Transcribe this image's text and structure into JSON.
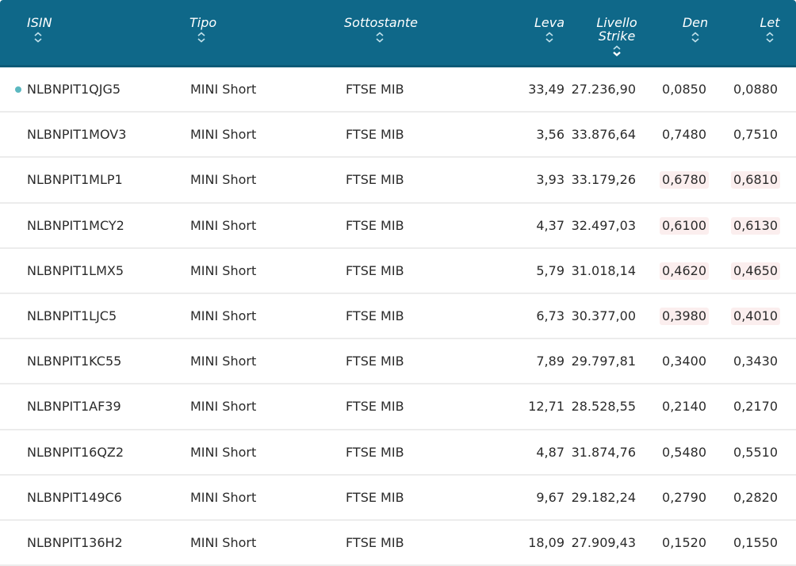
{
  "table": {
    "headers": {
      "isin": "ISIN",
      "tipo": "Tipo",
      "sottostante": "Sottostante",
      "leva": "Leva",
      "strike_line1": "Livello",
      "strike_line2": "Strike",
      "den": "Den",
      "let": "Let"
    },
    "sort_active_column": "strike",
    "colors": {
      "header_bg": "#0f6889",
      "dot": "#5bb8c0",
      "neg_highlight": "#fbeeee"
    },
    "rows": [
      {
        "isin": "NLBNPIT1QJG5",
        "tipo": "MINI Short",
        "sottostante": "FTSE MIB",
        "leva": "33,49",
        "strike": "27.236,90",
        "den": "0,0850",
        "let": "0,0880",
        "dot": true,
        "highlight": false
      },
      {
        "isin": "NLBNPIT1MOV3",
        "tipo": "MINI Short",
        "sottostante": "FTSE MIB",
        "leva": "3,56",
        "strike": "33.876,64",
        "den": "0,7480",
        "let": "0,7510",
        "dot": false,
        "highlight": false
      },
      {
        "isin": "NLBNPIT1MLP1",
        "tipo": "MINI Short",
        "sottostante": "FTSE MIB",
        "leva": "3,93",
        "strike": "33.179,26",
        "den": "0,6780",
        "let": "0,6810",
        "dot": false,
        "highlight": true
      },
      {
        "isin": "NLBNPIT1MCY2",
        "tipo": "MINI Short",
        "sottostante": "FTSE MIB",
        "leva": "4,37",
        "strike": "32.497,03",
        "den": "0,6100",
        "let": "0,6130",
        "dot": false,
        "highlight": true
      },
      {
        "isin": "NLBNPIT1LMX5",
        "tipo": "MINI Short",
        "sottostante": "FTSE MIB",
        "leva": "5,79",
        "strike": "31.018,14",
        "den": "0,4620",
        "let": "0,4650",
        "dot": false,
        "highlight": true
      },
      {
        "isin": "NLBNPIT1LJC5",
        "tipo": "MINI Short",
        "sottostante": "FTSE MIB",
        "leva": "6,73",
        "strike": "30.377,00",
        "den": "0,3980",
        "let": "0,4010",
        "dot": false,
        "highlight": true
      },
      {
        "isin": "NLBNPIT1KC55",
        "tipo": "MINI Short",
        "sottostante": "FTSE MIB",
        "leva": "7,89",
        "strike": "29.797,81",
        "den": "0,3400",
        "let": "0,3430",
        "dot": false,
        "highlight": false
      },
      {
        "isin": "NLBNPIT1AF39",
        "tipo": "MINI Short",
        "sottostante": "FTSE MIB",
        "leva": "12,71",
        "strike": "28.528,55",
        "den": "0,2140",
        "let": "0,2170",
        "dot": false,
        "highlight": false
      },
      {
        "isin": "NLBNPIT16QZ2",
        "tipo": "MINI Short",
        "sottostante": "FTSE MIB",
        "leva": "4,87",
        "strike": "31.874,76",
        "den": "0,5480",
        "let": "0,5510",
        "dot": false,
        "highlight": false
      },
      {
        "isin": "NLBNPIT149C6",
        "tipo": "MINI Short",
        "sottostante": "FTSE MIB",
        "leva": "9,67",
        "strike": "29.182,24",
        "den": "0,2790",
        "let": "0,2820",
        "dot": false,
        "highlight": false
      },
      {
        "isin": "NLBNPIT136H2",
        "tipo": "MINI Short",
        "sottostante": "FTSE MIB",
        "leva": "18,09",
        "strike": "27.909,43",
        "den": "0,1520",
        "let": "0,1550",
        "dot": false,
        "highlight": false
      }
    ]
  }
}
